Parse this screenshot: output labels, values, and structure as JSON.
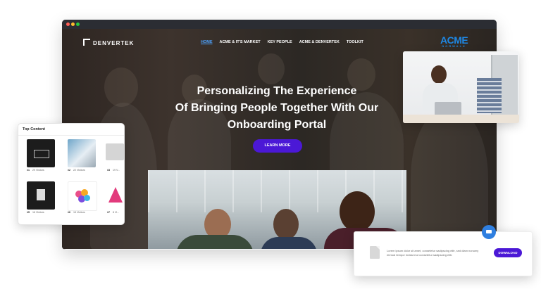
{
  "app": {
    "brand": "DENVERTEK",
    "partner_logo": "ACME",
    "partner_tagline": "NORWALK"
  },
  "nav": {
    "items": [
      "HOME",
      "ACME & IT'S MARKET",
      "KEY PEOPLE",
      "ACME & DENVERTEK",
      "TOOLKIT"
    ],
    "active": "HOME"
  },
  "hero": {
    "headline_1": "Personalizing The Experience",
    "headline_2": "Of Bringing People Together With Our",
    "headline_3": "Onboarding Portal",
    "cta": "LEARN MORE"
  },
  "top_content": {
    "title": "Top Content",
    "tiles": [
      {
        "rank": "#1",
        "label": "29 Visitors"
      },
      {
        "rank": "#2",
        "label": "22 Visitors"
      },
      {
        "rank": "#3",
        "label": "19 V..."
      },
      {
        "rank": "#5",
        "label": "16 Visitors"
      },
      {
        "rank": "#6",
        "label": "15 Visitors"
      },
      {
        "rank": "#7",
        "label": "8 Vi..."
      }
    ]
  },
  "download_card": {
    "text": "Lorem ipsum dolor sit amet, consetetur sadipscing elitr, sed diam nonumy eirmod tempor invidunt ut consetetur sadipscing elitr.",
    "button": "DOWNLOAD"
  },
  "colors": {
    "accent": "#4b18d6",
    "link_active": "#4ea3ff",
    "acme_blue": "#1e88e5"
  }
}
